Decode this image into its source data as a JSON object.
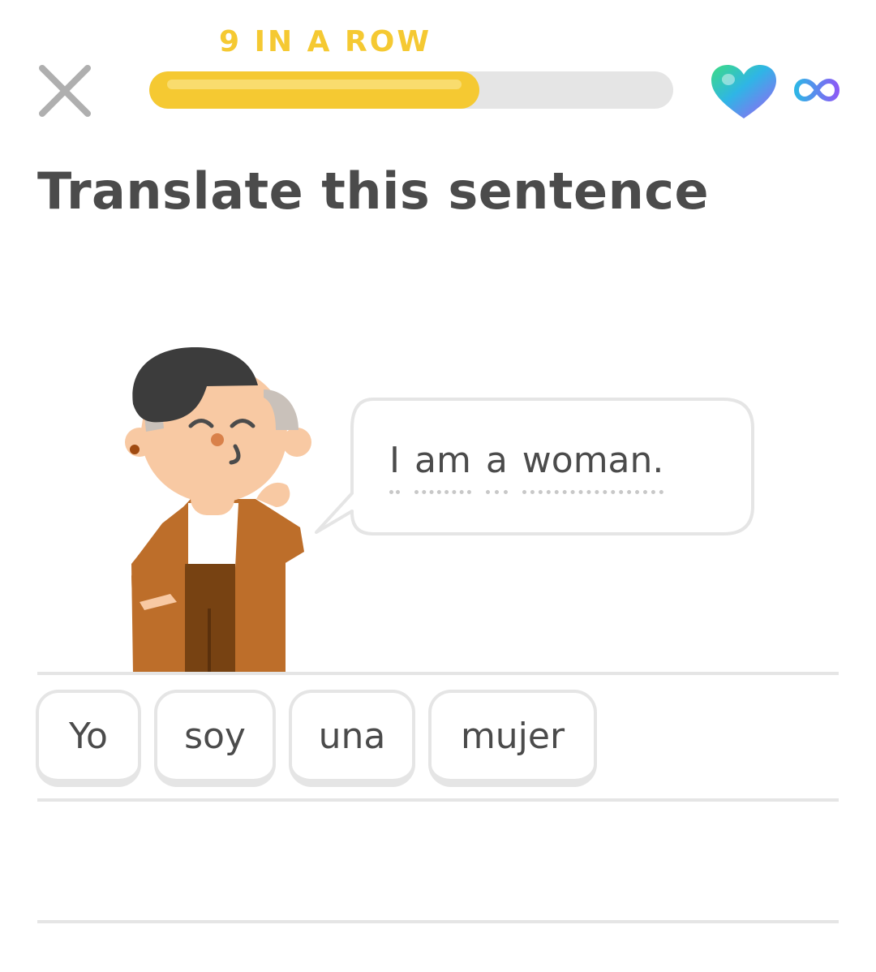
{
  "header": {
    "streak_label": "9 IN A ROW",
    "progress_fraction": 0.63,
    "hearts": "∞",
    "colors": {
      "streak": "#f5c932",
      "progress_fill": "#f5c932",
      "progress_track": "#e5e5e5",
      "close_icon": "#afafaf"
    },
    "icons": {
      "close": "close-icon",
      "hearts": "heart-icon",
      "unlimited": "infinity-icon"
    }
  },
  "challenge": {
    "title": "Translate this sentence",
    "prompt_words": [
      "I",
      "am",
      "a",
      "woman."
    ]
  },
  "word_bank": {
    "chips": [
      "Yo",
      "soy",
      "una",
      "mujer"
    ]
  }
}
